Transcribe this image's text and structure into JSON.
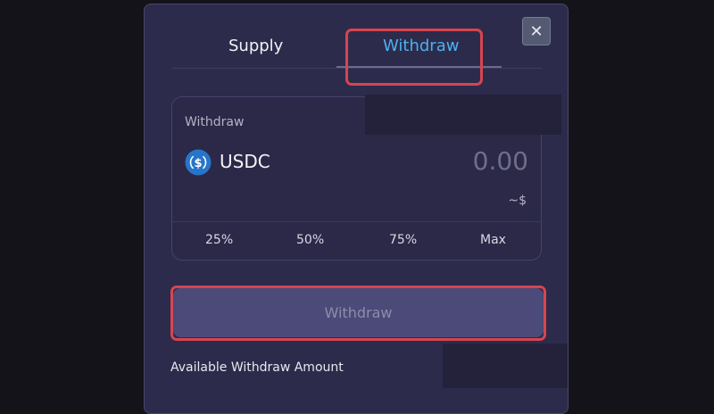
{
  "tabs": {
    "supply_label": "Supply",
    "withdraw_label": "Withdraw",
    "active": "Withdraw"
  },
  "close_icon_glyph": "✕",
  "panel": {
    "label": "Withdraw",
    "token_name": "USDC",
    "token_icon": "usdc-icon",
    "amount_placeholder": "0.00",
    "usd_value": "~$",
    "percent_options": [
      "25%",
      "50%",
      "75%",
      "Max"
    ]
  },
  "action_button_label": "Withdraw",
  "available_label": "Available Withdraw Amount",
  "colors": {
    "accent_tab": "#4db0f0",
    "highlight": "#d64550",
    "usdc_blue": "#2775ca"
  }
}
